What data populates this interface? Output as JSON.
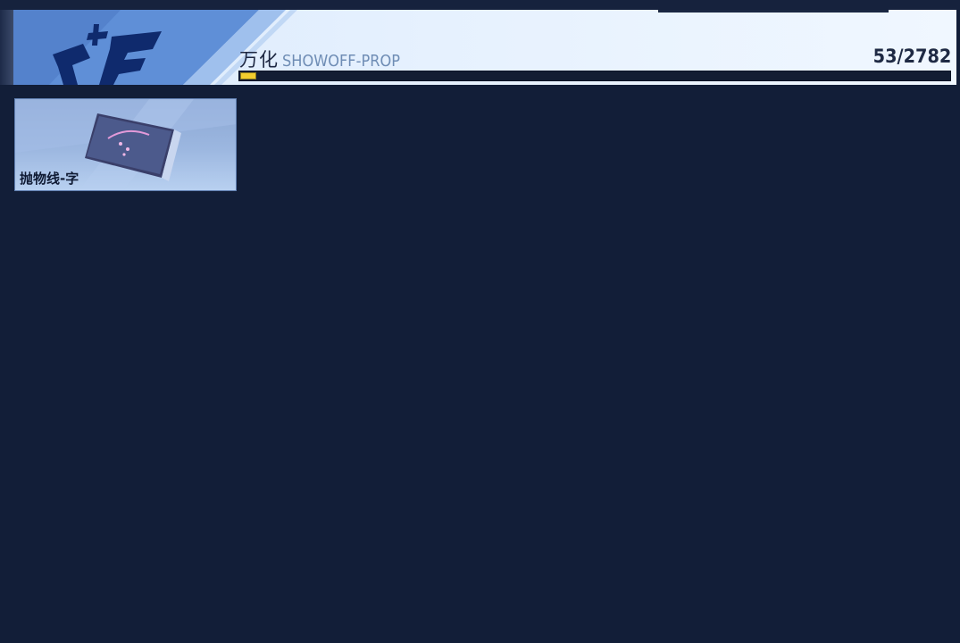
{
  "header": {
    "category_cn": "万化",
    "category_en": "SHOWOFF-PROP",
    "count": "53/2782",
    "progress": {
      "collected": 53,
      "total": 2782
    }
  },
  "items": [
    {
      "label": "抛物线-字"
    }
  ],
  "colors": {
    "background": "#121e38",
    "banner": "#e2eefd",
    "progress_fill": "#f2cd2e",
    "card": "#9cb7e0"
  },
  "icons": {
    "logo": "qf-logo-icon",
    "card_art": "phone-prop-icon"
  }
}
